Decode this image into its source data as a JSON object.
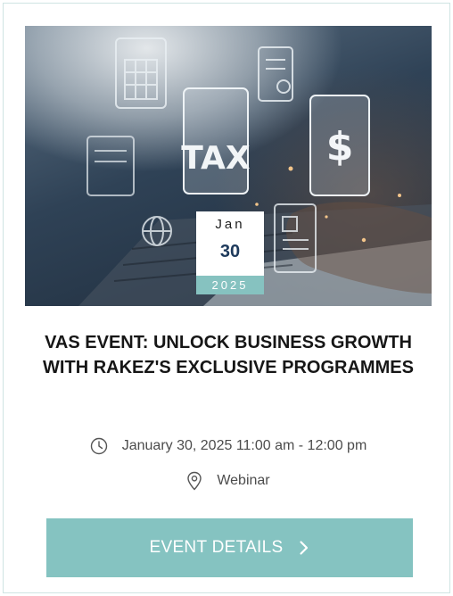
{
  "event": {
    "image_icons": [
      "tax-icon",
      "dollar-icon",
      "spreadsheet-icon",
      "document-icon",
      "laptop-icon",
      "globe-icon"
    ],
    "image_text": {
      "tax": "TAX",
      "dollar": "$"
    },
    "date": {
      "month": "Jan",
      "day": "30",
      "year": "2025"
    },
    "title_line1": "VAS EVENT: UNLOCK BUSINESS GROWTH",
    "title_line2": "WITH RAKEZ'S EXCLUSIVE PROGRAMMES",
    "time_text": "January 30, 2025 11:00 am - 12:00 pm",
    "location_text": "Webinar",
    "cta_label": "EVENT DETAILS"
  },
  "colors": {
    "accent": "#85c3c1",
    "date_day": "#1e3a5c",
    "border": "#cfe4e3"
  }
}
